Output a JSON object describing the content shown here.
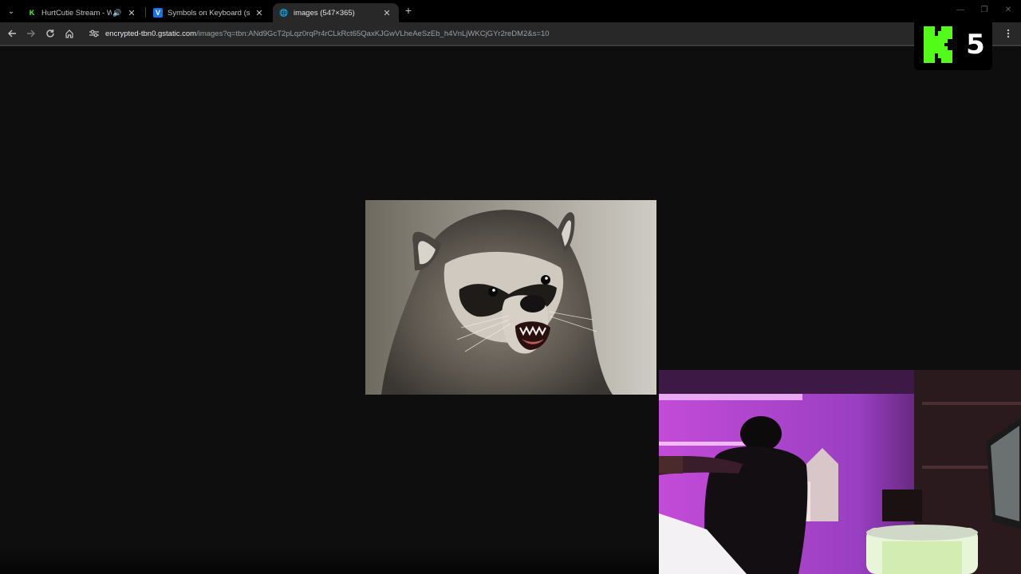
{
  "browser": {
    "tabs": [
      {
        "title": "HurtCutie Stream - Watch L",
        "favicon": "kick-logo-icon",
        "audio": true,
        "active": false
      },
      {
        "title": "Symbols on Keyboard (shortcu",
        "favicon": "v-logo-icon",
        "audio": false,
        "active": false
      },
      {
        "title": "images (547×365)",
        "favicon": "globe-icon",
        "audio": false,
        "active": true
      }
    ],
    "new_tab_label": "+",
    "url_host": "encrypted-tbn0.gstatic.com",
    "url_path": "/images?q=tbn:ANd9GcT2pLqz0rqPr4rCLkRct65QaxKJGwVLheAeSzEb_h4VnLjWKCjGYr2reDM2&s=10"
  },
  "viewer": {
    "image_subject": "raccoon-photo",
    "background": "#0e0e0e"
  },
  "overlay": {
    "kick_count": "5",
    "kick_color": "#53fc18"
  },
  "webcam": {
    "scene": "webcam-feed"
  }
}
